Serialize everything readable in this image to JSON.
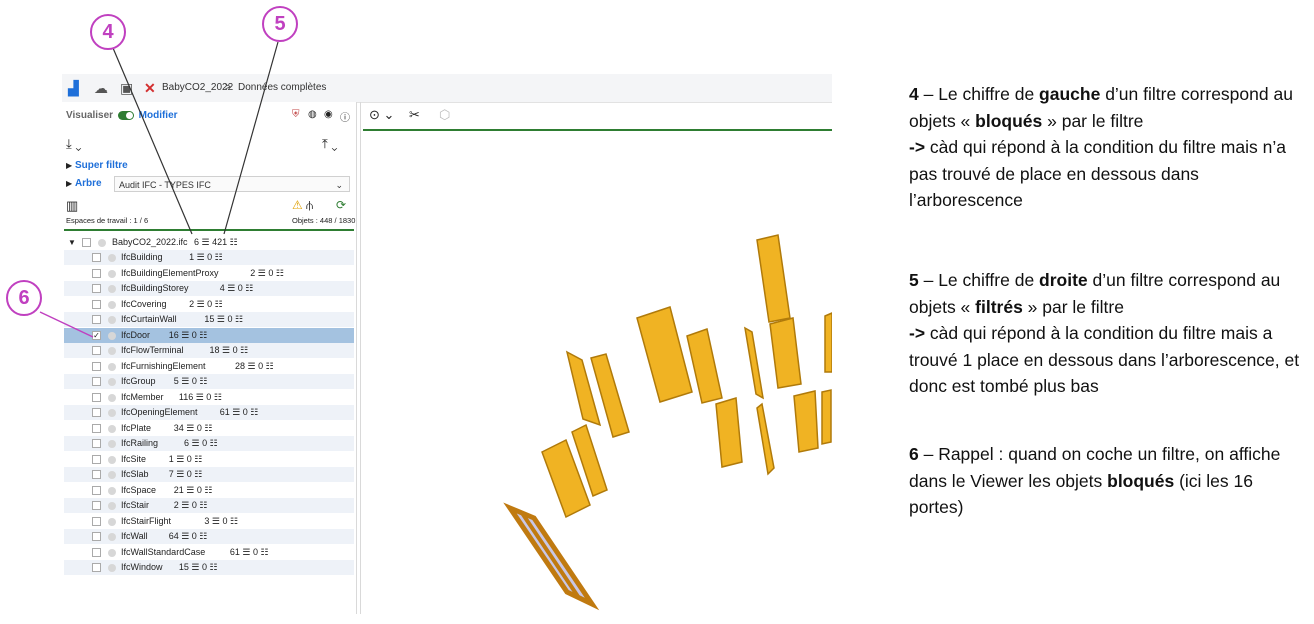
{
  "toolbar": {
    "project": "BabyCO2_2022",
    "separator": ">",
    "dataset": "Données complètes"
  },
  "panel": {
    "visualiser": "Visualiser",
    "modifier": "Modifier",
    "super_filtre": "Super filtre",
    "arbre": "Arbre",
    "arbre_select": "Audit IFC - TYPES IFC",
    "espaces": "Espaces de travail : 1 / 6",
    "objets": "Objets : 448 / 1830"
  },
  "tree": {
    "root": {
      "label": "BabyCO2_2022.ifc",
      "counts": "6 ☰ 421 ☷"
    },
    "items": [
      {
        "label": "IfcBuilding",
        "counts": "1 ☰ 0 ☷",
        "checked": false
      },
      {
        "label": "IfcBuildingElementProxy",
        "counts": "2 ☰ 0 ☷",
        "checked": false
      },
      {
        "label": "IfcBuildingStorey",
        "counts": "4 ☰ 0 ☷",
        "checked": false
      },
      {
        "label": "IfcCovering",
        "counts": "2 ☰ 0 ☷",
        "checked": false
      },
      {
        "label": "IfcCurtainWall",
        "counts": "15 ☰ 0 ☷",
        "checked": false
      },
      {
        "label": "IfcDoor",
        "counts": "16 ☰ 0 ☷",
        "checked": true
      },
      {
        "label": "IfcFlowTerminal",
        "counts": "18 ☰ 0 ☷",
        "checked": false
      },
      {
        "label": "IfcFurnishingElement",
        "counts": "28 ☰ 0 ☷",
        "checked": false
      },
      {
        "label": "IfcGroup",
        "counts": "5 ☰ 0 ☷",
        "checked": false
      },
      {
        "label": "IfcMember",
        "counts": "116 ☰ 0 ☷",
        "checked": false
      },
      {
        "label": "IfcOpeningElement",
        "counts": "61 ☰ 0 ☷",
        "checked": false
      },
      {
        "label": "IfcPlate",
        "counts": "34 ☰ 0 ☷",
        "checked": false
      },
      {
        "label": "IfcRailing",
        "counts": "6 ☰ 0 ☷",
        "checked": false
      },
      {
        "label": "IfcSite",
        "counts": "1 ☰ 0 ☷",
        "checked": false
      },
      {
        "label": "IfcSlab",
        "counts": "7 ☰ 0 ☷",
        "checked": false
      },
      {
        "label": "IfcSpace",
        "counts": "21 ☰ 0 ☷",
        "checked": false
      },
      {
        "label": "IfcStair",
        "counts": "2 ☰ 0 ☷",
        "checked": false
      },
      {
        "label": "IfcStairFlight",
        "counts": "3 ☰ 0 ☷",
        "checked": false
      },
      {
        "label": "IfcWall",
        "counts": "64 ☰ 0 ☷",
        "checked": false
      },
      {
        "label": "IfcWallStandardCase",
        "counts": "61 ☰ 0 ☷",
        "checked": false
      },
      {
        "label": "IfcWindow",
        "counts": "15 ☰ 0 ☷",
        "checked": false
      }
    ]
  },
  "callouts": {
    "c4": "4",
    "c5": "5",
    "c6": "6"
  },
  "notes": {
    "n4_num": "4",
    "n4_a": " – Le chiffre de ",
    "n4_b": "gauche",
    "n4_c": " d’un filtre correspond au objets « ",
    "n4_d": "bloqués",
    "n4_e": " » par le filtre",
    "n4_f1": "->",
    "n4_f2": " càd qui répond à la condition du filtre mais n’a pas trouvé de place en dessous dans l’arborescence",
    "n5_num": "5",
    "n5_a": " – Le chiffre de ",
    "n5_b": "droite",
    "n5_c": " d’un filtre correspond au objets « ",
    "n5_d": "filtrés",
    "n5_e": " » par le filtre",
    "n5_f1": "->",
    "n5_f2": " càd qui répond à la condition du filtre mais a trouvé 1 place en dessous dans l’arborescence, et donc est tombé plus bas",
    "n6_num": "6",
    "n6_a": " – Rappel : quand on coche un filtre, on affiche dans le Viewer les objets ",
    "n6_b": "bloqués",
    "n6_c": " (ici les 16 portes)"
  },
  "colors": {
    "accent_green": "#2e7d32",
    "link_blue": "#1e6fd9",
    "callout": "#c040c0",
    "door": "#f0b323",
    "selected_row": "#a4c2e0"
  }
}
